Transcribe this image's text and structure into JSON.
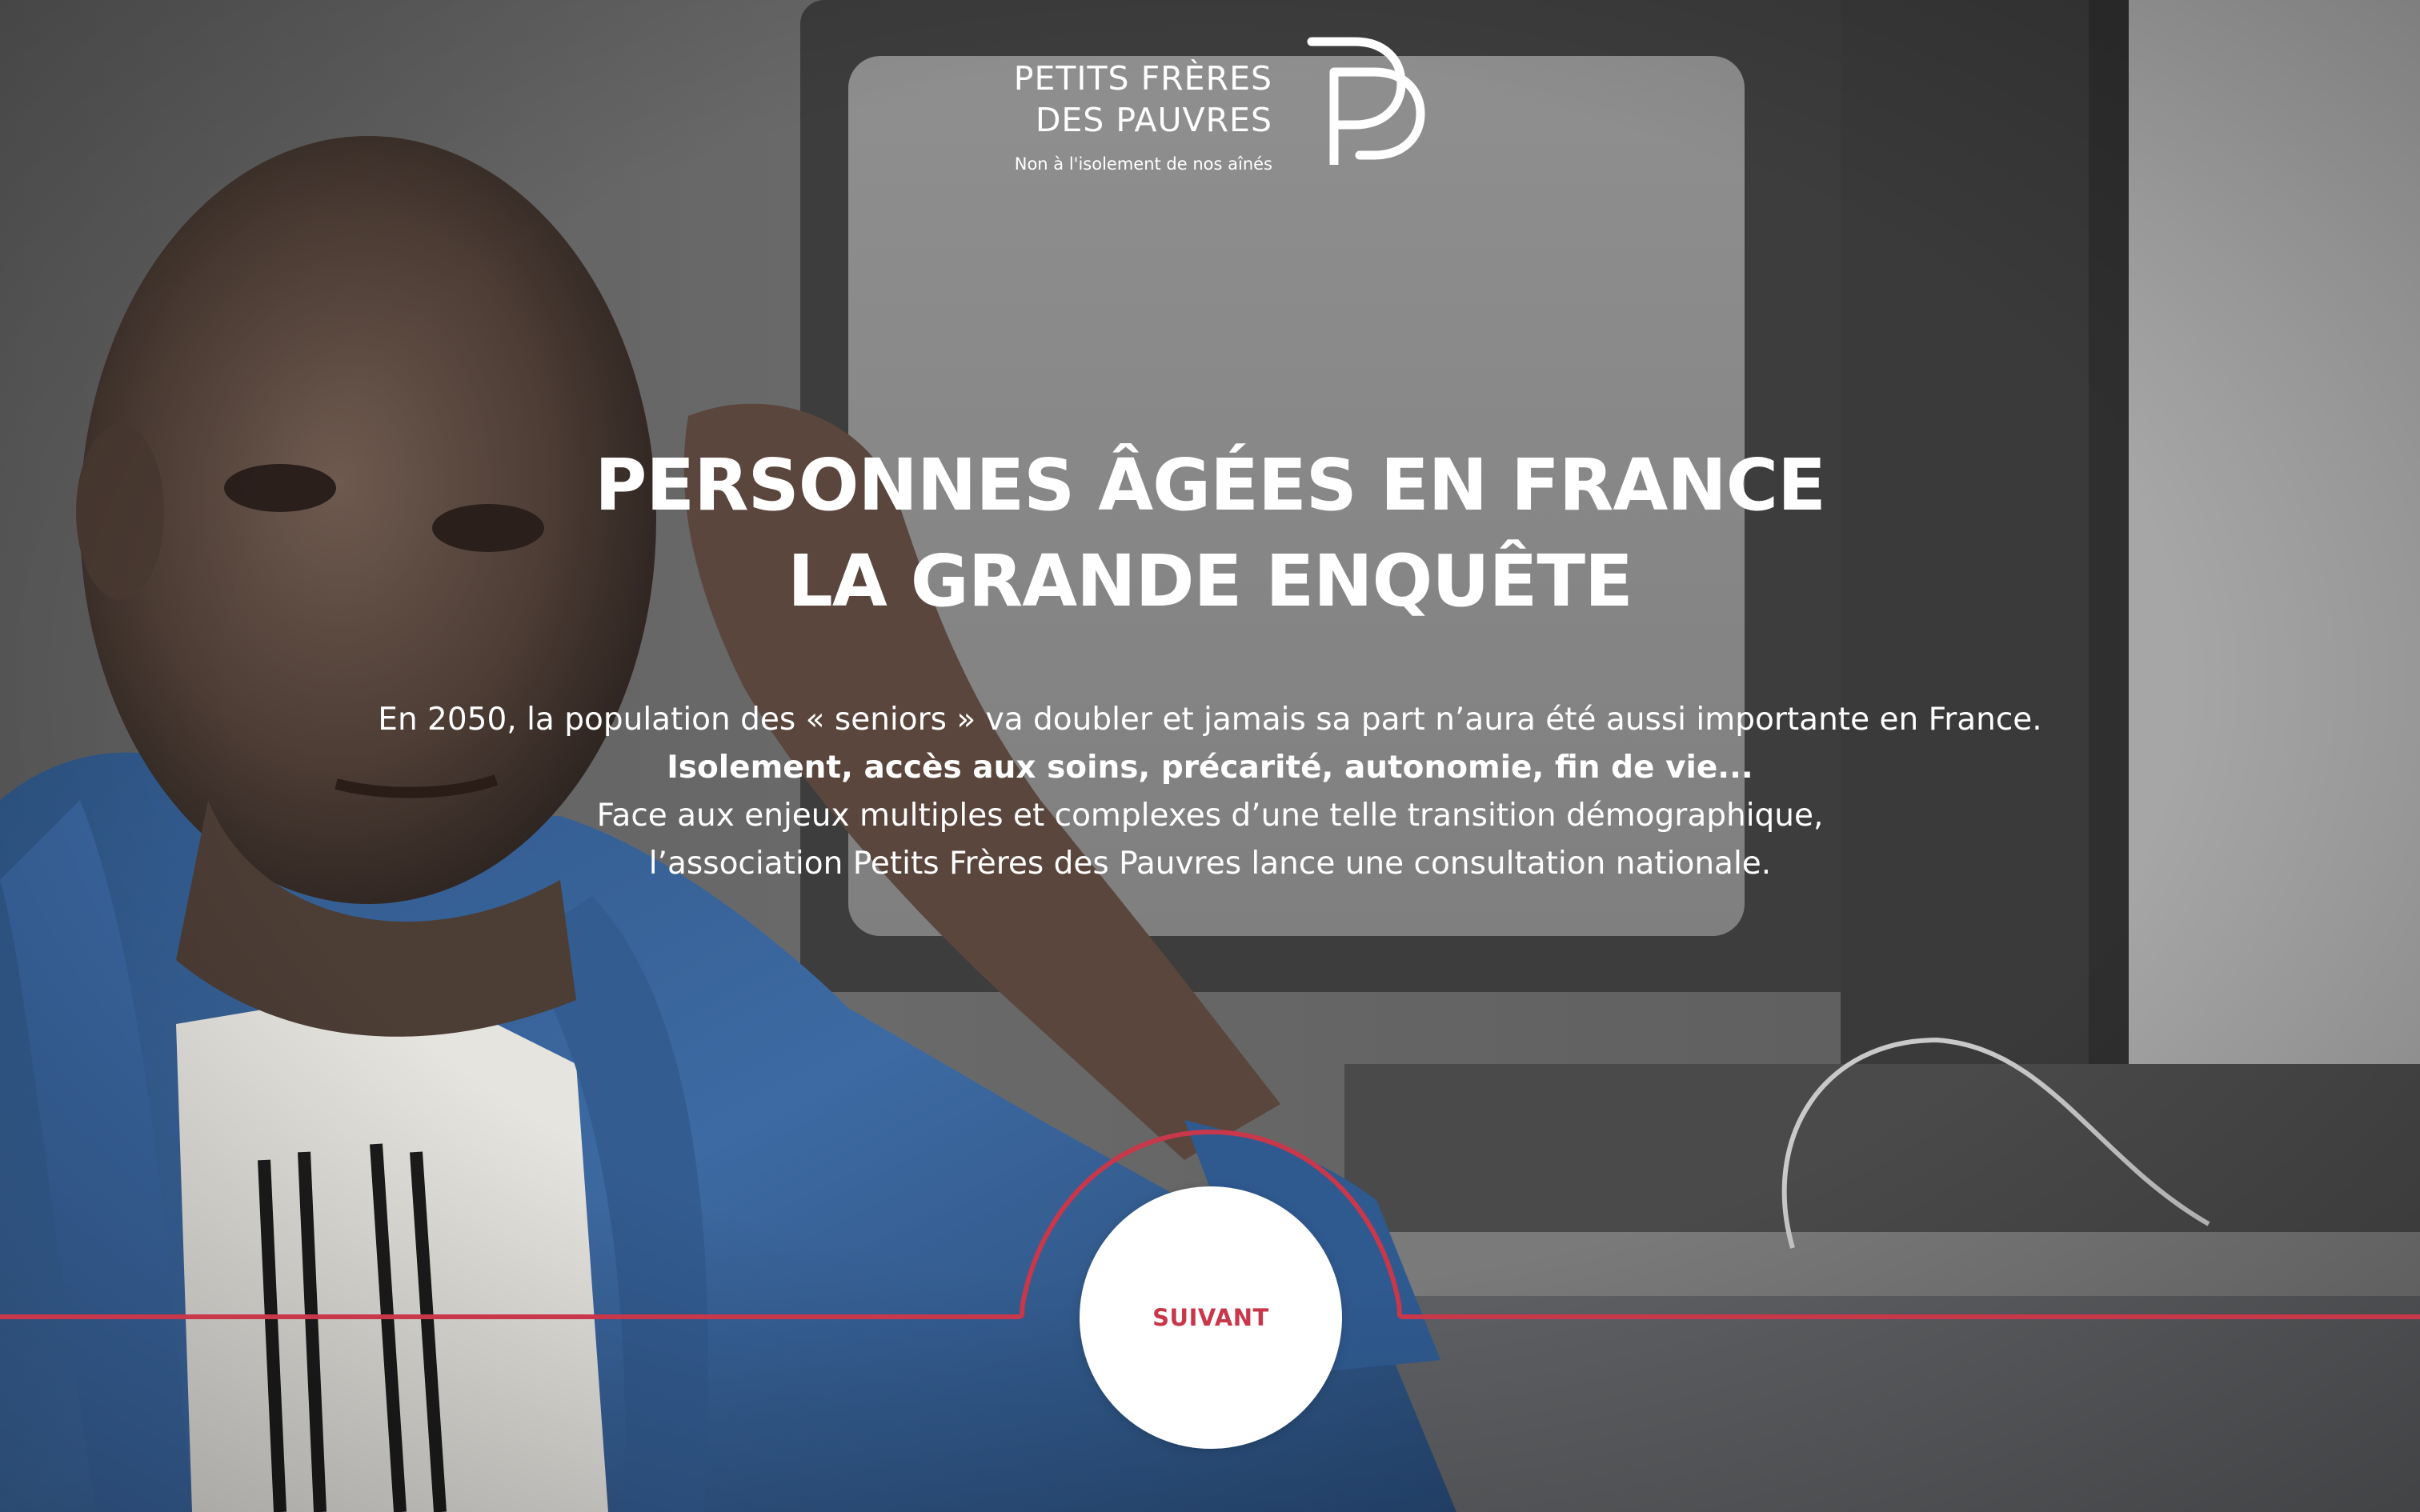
{
  "brand": {
    "name_line1": "PETITS FRÈRES",
    "name_line2": "DES PAUVRES",
    "tagline": "Non à l'isolement de nos aînés"
  },
  "hero": {
    "title_line1": "PERSONNES ÂGÉES EN FRANCE",
    "title_line2": "LA GRANDE ENQUÊTE",
    "intro_line1": "En 2050, la population des « seniors » va doubler et jamais sa part n’aura été aussi importante en France.",
    "intro_line2": "Isolement, accès aux soins, précarité, autonomie, fin de vie...",
    "intro_line3": "Face aux enjeux multiples et complexes d’une telle transition démographique,",
    "intro_line4": "l’association Petits Frères des Pauvres lance une consultation nationale."
  },
  "navigation": {
    "next_label": "SUIVANT"
  },
  "icons": {
    "logo": "pp-monogram-icon"
  },
  "colors": {
    "accent": "#c8374a",
    "text_on_photo": "#ffffff",
    "button_bg": "#ffffff"
  }
}
